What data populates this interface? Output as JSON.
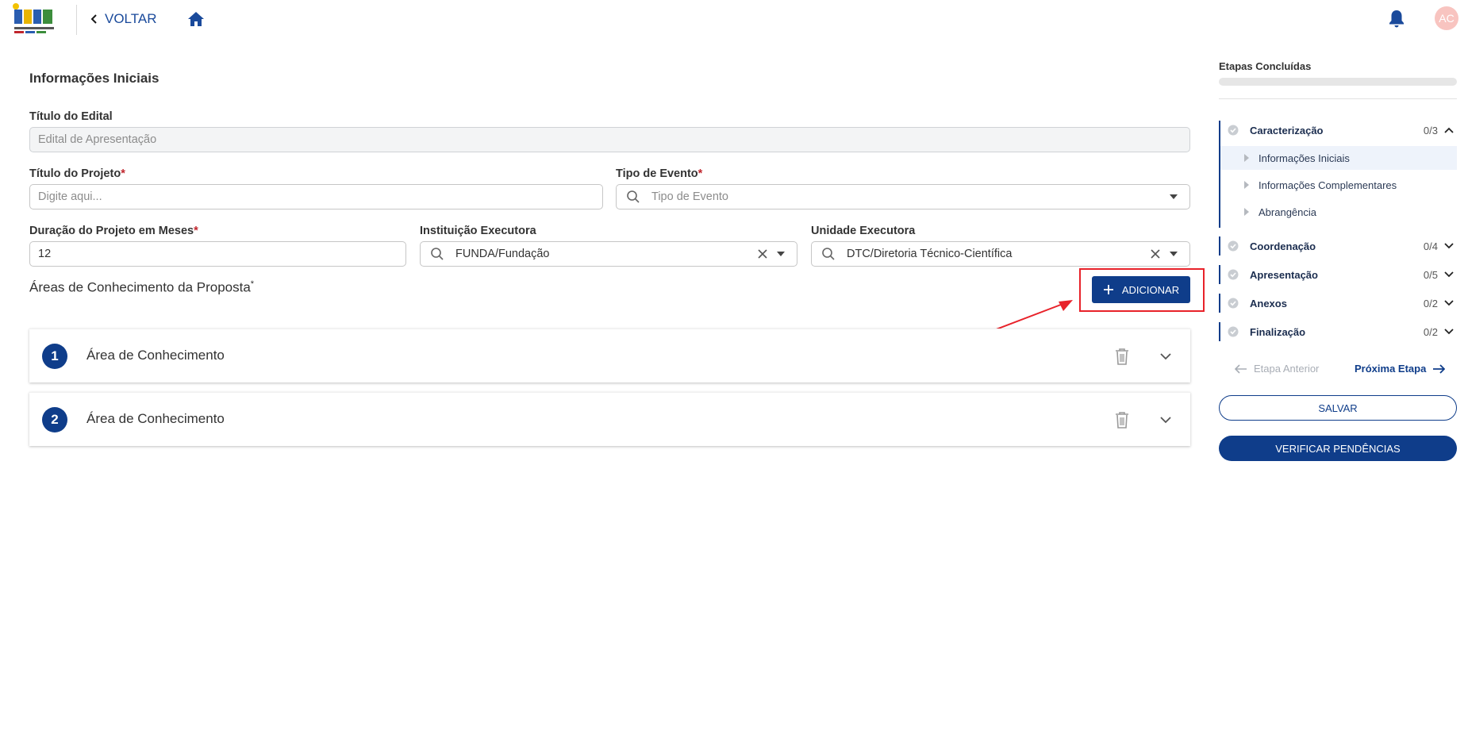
{
  "header": {
    "back_label": "VOLTAR",
    "avatar_initials": "AC"
  },
  "form": {
    "section_title": "Informações Iniciais",
    "titulo_edital": {
      "label": "Título do Edital",
      "value": "Edital de Apresentação"
    },
    "titulo_projeto": {
      "label": "Título do Projeto",
      "required_mark": "*",
      "placeholder": "Digite aqui..."
    },
    "tipo_evento": {
      "label": "Tipo de Evento",
      "required_mark": "*",
      "placeholder": "Tipo de Evento"
    },
    "duracao": {
      "label": "Duração do Projeto em Meses",
      "required_mark": "*",
      "value": "12"
    },
    "instituicao": {
      "label": "Instituição Executora",
      "value": "FUNDA/Fundação"
    },
    "unidade": {
      "label": "Unidade Executora",
      "value": "DTC/Diretoria Técnico-Científica"
    },
    "areas_title": "Áreas de Conhecimento da Proposta",
    "areas_required_mark": "*",
    "add_button": "ADICIONAR",
    "areas": [
      {
        "number": "1",
        "label": "Área de Conhecimento"
      },
      {
        "number": "2",
        "label": "Área de Conhecimento"
      }
    ]
  },
  "sidebar": {
    "title": "Etapas Concluídas",
    "progress": 0,
    "steps": [
      {
        "name": "Caracterização",
        "count": "0/3",
        "expanded": true,
        "substeps": [
          "Informações Iniciais",
          "Informações Complementares",
          "Abrangência"
        ]
      },
      {
        "name": "Coordenação",
        "count": "0/4"
      },
      {
        "name": "Apresentação",
        "count": "0/5"
      },
      {
        "name": "Anexos",
        "count": "0/2"
      },
      {
        "name": "Finalização",
        "count": "0/2"
      }
    ],
    "prev_label": "Etapa Anterior",
    "next_label": "Próxima Etapa",
    "save_label": "SALVAR",
    "verify_label": "VERIFICAR PENDÊNCIAS"
  },
  "colors": {
    "primary": "#0f3d8a",
    "required": "#c0262d",
    "highlight": "#e8222a",
    "avatar_bg": "#f8c4c0"
  }
}
